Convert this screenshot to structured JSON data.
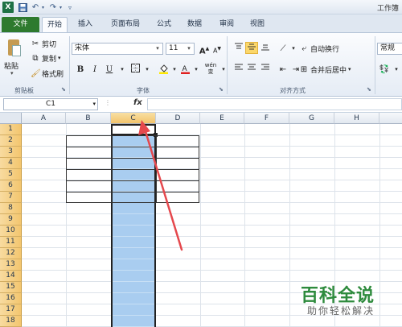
{
  "titlebar": {
    "title": "工作簿",
    "logo_letter": "X",
    "save_icon": "save-icon",
    "undo_icon": "undo-icon",
    "redo_icon": "redo-icon"
  },
  "tabs": [
    {
      "label": "文件"
    },
    {
      "label": "开始"
    },
    {
      "label": "插入"
    },
    {
      "label": "页面布局"
    },
    {
      "label": "公式"
    },
    {
      "label": "数据"
    },
    {
      "label": "审阅"
    },
    {
      "label": "视图"
    }
  ],
  "clipboard": {
    "paste": "粘贴",
    "cut": "剪切",
    "copy": "复制",
    "format_painter": "格式刷",
    "group_label": "剪贴板"
  },
  "font": {
    "name": "宋体",
    "size": "11",
    "bold": "B",
    "italic": "I",
    "underline": "U",
    "grow": "A",
    "shrink": "A",
    "group_label": "字体",
    "wen": "wén"
  },
  "alignment": {
    "wrap": "自动换行",
    "merge": "合并后居中",
    "group_label": "对齐方式"
  },
  "number": {
    "format": "常规"
  },
  "formula_bar": {
    "cell_ref": "C1",
    "fx": "fx",
    "value": ""
  },
  "columns": [
    "A",
    "B",
    "C",
    "D",
    "E",
    "F",
    "G",
    "H"
  ],
  "rows": [
    "1",
    "2",
    "3",
    "4",
    "5",
    "6",
    "7",
    "8",
    "9",
    "10",
    "11",
    "12",
    "13",
    "14",
    "15",
    "16",
    "17",
    "18"
  ],
  "selected_column": "C",
  "colors": {
    "file_tab": "#2e7a2e",
    "selection": "#a9cdf0",
    "arrow": "#e5484d",
    "watermark": "#2e8b3d"
  },
  "watermark": {
    "main": "百科全说",
    "sub": "助你轻松解决"
  }
}
